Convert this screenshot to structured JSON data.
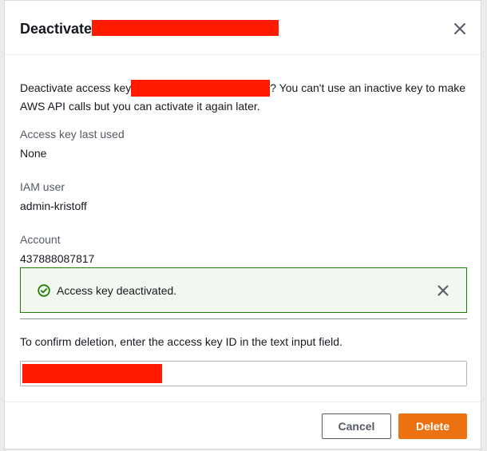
{
  "modal": {
    "title": "Deactivate",
    "close_icon": "close-icon"
  },
  "body": {
    "text_before": "Deactivate access key",
    "text_after": "? You can't use an inactive key to make AWS API calls but you can activate it again later."
  },
  "details": {
    "last_used_label": "Access key last used",
    "last_used_value": "None",
    "iam_user_label": "IAM user",
    "iam_user_value": "admin-kristoff",
    "account_label": "Account",
    "account_value": "437888087817"
  },
  "alert": {
    "message": "Access key deactivated.",
    "icon": "success-check-icon",
    "color": "#1d8102"
  },
  "confirm": {
    "instruction": "To confirm deletion, enter the access key ID in the text input field."
  },
  "footer": {
    "cancel_label": "Cancel",
    "delete_label": "Delete",
    "accent_color": "#ec7211"
  }
}
